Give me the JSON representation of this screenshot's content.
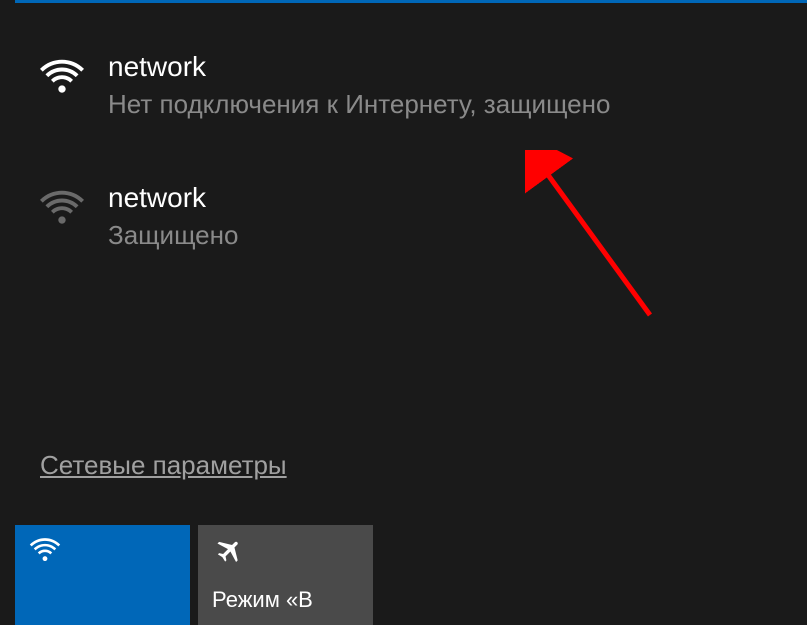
{
  "networks": [
    {
      "name": "network",
      "status": "Нет подключения к Интернету, защищено",
      "icon_color": "#ffffff"
    },
    {
      "name": "network",
      "status": "Защищено",
      "icon_color": "#6a6a6a"
    }
  ],
  "settings_link": "Сетевые параметры",
  "quick_actions": {
    "wifi": {
      "label": ""
    },
    "airplane": {
      "label": "Режим «В"
    }
  },
  "colors": {
    "accent": "#0067b8",
    "tile_gray": "#4a4a4a",
    "bg": "#1a1a1a",
    "arrow": "#ff0000"
  }
}
